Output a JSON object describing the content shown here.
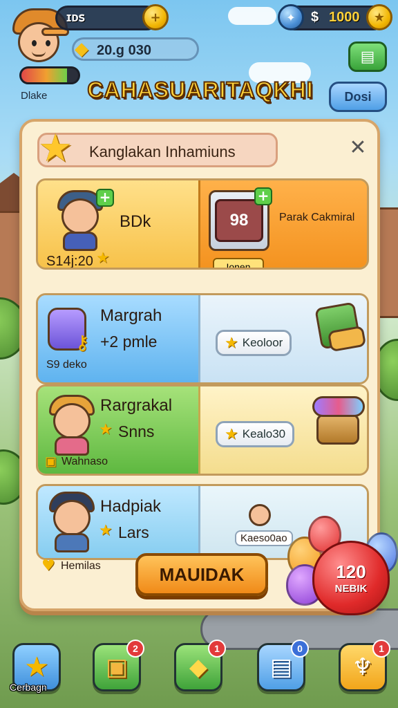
{
  "hud": {
    "player_currency_label": "𝔦𝔡𝔰",
    "player_currency_text": "ɪᴅꜱ",
    "gold_symbol": "$",
    "gold_amount": "1000",
    "gems_amount": "20.g 030",
    "player_name": "Dlake",
    "level_progress": 0.8
  },
  "header": {
    "title": "CAHASUARITAQKHI",
    "right_button": "Dosi"
  },
  "panel": {
    "title": "Kanglakan Inhamiuns",
    "offers": [
      {
        "name": "BDk",
        "price_text": "S14j:20",
        "right_name": "Parak Cakmiral",
        "right_button": "Ionen",
        "item_price": "98"
      },
      {
        "name": "Margrah",
        "sub": "+2 pmle",
        "foot": "S9 deko",
        "button": "Keoloor"
      },
      {
        "name": "Rargrakal",
        "sub": "Snns",
        "foot": "Wahnaso",
        "button": "Kealo30"
      },
      {
        "name": "Hadpiak",
        "sub": "Lars",
        "foot": "Hemilas",
        "side_label": "Kaeso0ao"
      }
    ],
    "buy_button": "MAUIDAK",
    "balloon_value": "120",
    "balloon_label": "NEBIK"
  },
  "nav": {
    "home_label": "Cerbagn",
    "badges": [
      "2",
      "1",
      "0",
      "1"
    ]
  },
  "colors": {
    "accent_orange": "#f08a18",
    "panel_bg": "#fbefd2",
    "gold": "#f2b705"
  }
}
